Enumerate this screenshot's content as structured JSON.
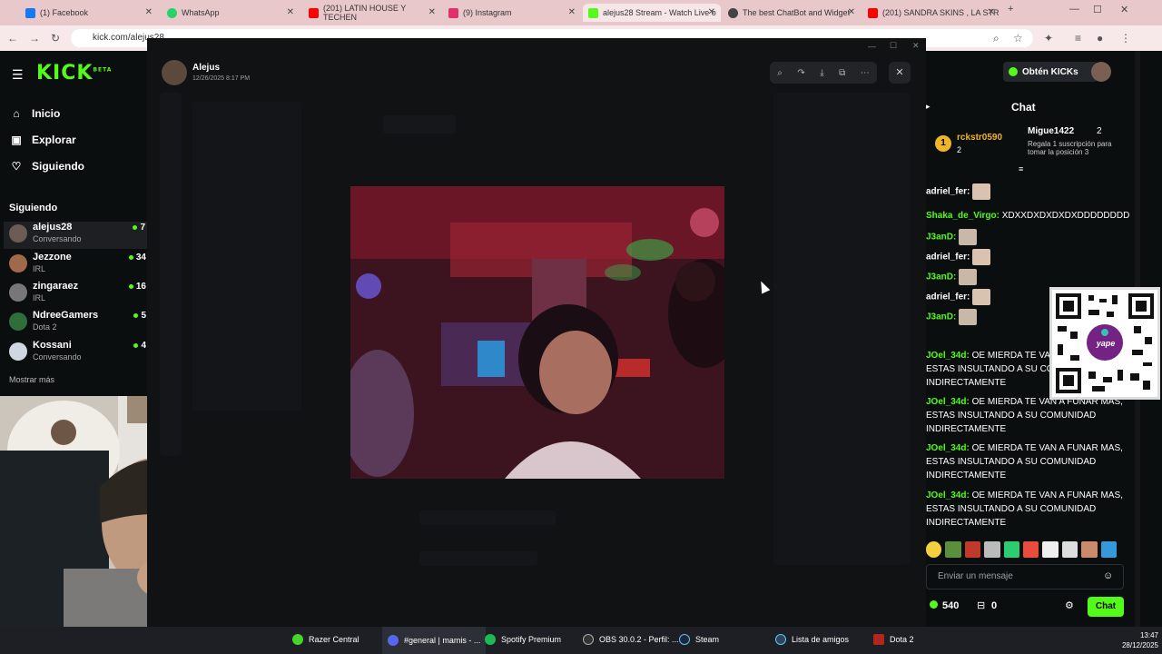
{
  "browser": {
    "tabs": [
      {
        "label": "(1) Facebook",
        "color": "#1877f2"
      },
      {
        "label": "WhatsApp",
        "color": "#25d366"
      },
      {
        "label": "(201) LATIN HOUSE Y TECHEN",
        "color": "#ff0000"
      },
      {
        "label": "(9) Instagram",
        "color": "#e1306c"
      },
      {
        "label": "alejus28 Stream - Watch Live o",
        "color": "#53fc18"
      },
      {
        "label": "The best ChatBot and Widget",
        "color": "#444444"
      },
      {
        "label": "(201) SANDRA SKINS , LA STR",
        "color": "#ff0000"
      }
    ],
    "new_tab": "+",
    "url": "kick.com/alejus28"
  },
  "kick": {
    "logo": "KICK",
    "logo_beta": "BETA",
    "nav": [
      {
        "label": "Inicio",
        "icon": "home-icon",
        "glyph": "⌂"
      },
      {
        "label": "Explorar",
        "icon": "compass-icon",
        "glyph": "▣"
      },
      {
        "label": "Siguiendo",
        "icon": "heart-icon",
        "glyph": "♡"
      }
    ],
    "following_heading": "Siguiendo",
    "following": [
      {
        "name": "alejus28",
        "sub": "Conversando",
        "count": "7"
      },
      {
        "name": "Jezzone",
        "sub": "IRL",
        "count": "34"
      },
      {
        "name": "zingaraez",
        "sub": "IRL",
        "count": "16"
      },
      {
        "name": "NdreeGamers",
        "sub": "Dota 2",
        "count": "5"
      },
      {
        "name": "Kossani",
        "sub": "Conversando",
        "count": "4"
      }
    ],
    "show_more": "Mostrar más"
  },
  "viewer": {
    "author": "Alejus",
    "timestamp": "12/26/2025 8:17 PM"
  },
  "chat": {
    "get_kicks": "Obtén KICKs",
    "title": "Chat",
    "leader1": {
      "name": "rckstr0590",
      "rank": "1",
      "count": "2"
    },
    "leader2": {
      "name": "Migue1422",
      "count": "2",
      "note": "Regala 1 suscripción para tomar la posición 3"
    },
    "messages": [
      {
        "user": "adriel_fer:",
        "text": "",
        "color": "#ffffff"
      },
      {
        "user": "Shaka_de_Virgo:",
        "text": "XDXXDXDXDXDXDDDDDDDD",
        "color": "#53fc18"
      },
      {
        "user": "J3anD:",
        "text": "",
        "color": "#53fc18"
      },
      {
        "user": "adriel_fer:",
        "text": "",
        "color": "#ffffff"
      },
      {
        "user": "J3anD:",
        "text": "",
        "color": "#53fc18"
      },
      {
        "user": "adriel_fer:",
        "text": "",
        "color": "#ffffff"
      },
      {
        "user": "J3anD:",
        "text": "",
        "color": "#53fc18"
      },
      {
        "user": "JOel_34d:",
        "text": "OE MIERDA TE VAN A FUNAR MAS, ESTAS INSULTANDO A SU COMUNIDAD INDIRECTAMENTE",
        "color": "#53fc18"
      },
      {
        "user": "JOel_34d:",
        "text": "OE MIERDA TE VAN A FUNAR MAS, ESTAS INSULTANDO A SU COMUNIDAD INDIRECTAMENTE",
        "color": "#53fc18"
      },
      {
        "user": "JOel_34d:",
        "text": "OE MIERDA TE VAN A FUNAR MAS, ESTAS INSULTANDO A SU COMUNIDAD INDIRECTAMENTE",
        "color": "#53fc18"
      },
      {
        "user": "JOel_34d:",
        "text": "OE MIERDA TE VAN A FUNAR MAS, ESTAS INSULTANDO A SU COMUNIDAD INDIRECTAMENTE",
        "color": "#53fc18"
      }
    ],
    "input_placeholder": "Enviar un mensaje",
    "kicks_count": "540",
    "gift_count": "0",
    "send_label": "Chat",
    "qr_brand": "yape"
  },
  "taskbar": {
    "items": [
      {
        "label": "Razer Central",
        "color": "#44d62c"
      },
      {
        "label": "#general | mamis - ...",
        "color": "#5865f2"
      },
      {
        "label": "Spotify Premium",
        "color": "#1db954"
      },
      {
        "label": "OBS 30.0.2 - Perfil: ...",
        "color": "#333333"
      },
      {
        "label": "Steam",
        "color": "#1b2838"
      },
      {
        "label": "Lista de amigos",
        "color": "#2a475e"
      },
      {
        "label": "Dota 2",
        "color": "#b3261e"
      }
    ],
    "time": "13:47",
    "date": "28/12/2025"
  }
}
